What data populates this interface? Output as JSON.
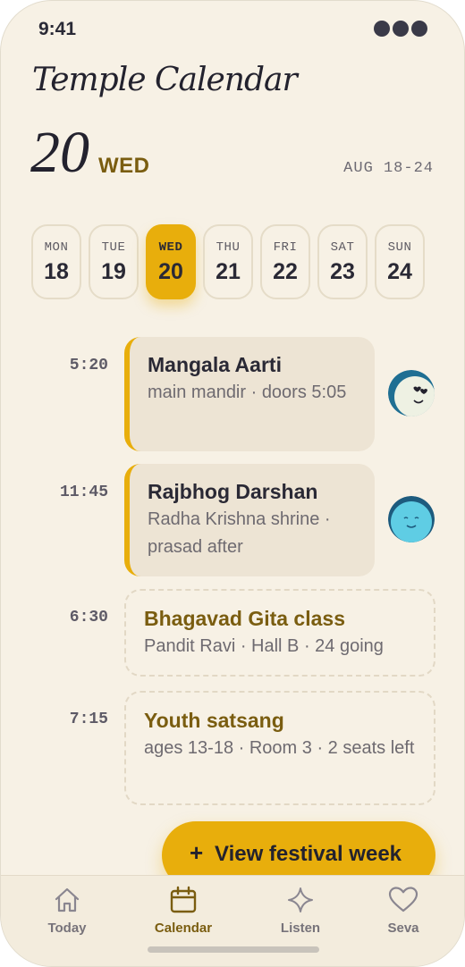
{
  "status": {
    "time": "9:41"
  },
  "header": {
    "title": "Temple Calendar",
    "day_number": "20",
    "day_name": "WED",
    "week_range": "AUG 18-24"
  },
  "week": [
    {
      "dow": "MON",
      "date": "18",
      "active": false
    },
    {
      "dow": "TUE",
      "date": "19",
      "active": false
    },
    {
      "dow": "WED",
      "date": "20",
      "active": true
    },
    {
      "dow": "THU",
      "date": "21",
      "active": false
    },
    {
      "dow": "FRI",
      "date": "22",
      "active": false
    },
    {
      "dow": "SAT",
      "date": "23",
      "active": false
    },
    {
      "dow": "SUN",
      "date": "24",
      "active": false
    }
  ],
  "events": [
    {
      "time": "5:20",
      "title": "Mangala Aarti",
      "subtitle": "main mandir · doors 5:05",
      "style": "filled"
    },
    {
      "time": "11:45",
      "title": "Rajbhog Darshan",
      "subtitle": "Radha Krishna shrine · prasad after",
      "style": "filled"
    },
    {
      "time": "6:30",
      "title": "Bhagavad Gita class",
      "subtitle": "Pandit Ravi · Hall B · 24 going",
      "style": "dashed"
    },
    {
      "time": "7:15",
      "title": "Youth satsang",
      "subtitle": "ages 13-18 · Room 3 · 2 seats left",
      "style": "dashed"
    }
  ],
  "fab": {
    "plus": "+",
    "label": "View festival week"
  },
  "tabs": [
    {
      "label": "Today",
      "icon": "home-icon",
      "active": false
    },
    {
      "label": "Calendar",
      "icon": "calendar-icon",
      "active": true
    },
    {
      "label": "Listen",
      "icon": "sparkle-icon",
      "active": false
    },
    {
      "label": "Seva",
      "icon": "heart-icon",
      "active": false
    }
  ],
  "colors": {
    "accent": "#e8ae0c",
    "accent_text": "#7a5d10",
    "background": "#f7f1e5",
    "card": "#ede4d4"
  }
}
